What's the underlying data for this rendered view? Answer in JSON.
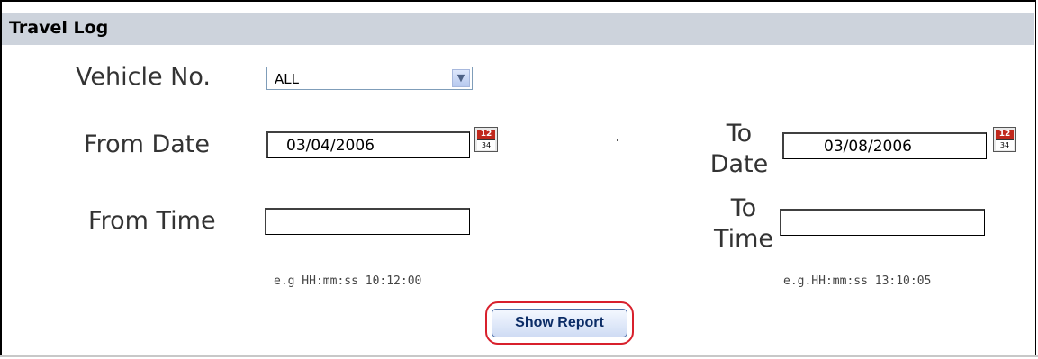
{
  "header": {
    "title": "Travel Log"
  },
  "form": {
    "vehicle_label": "Vehicle No.",
    "vehicle_value": "ALL",
    "from_date_label": "From Date",
    "from_date_value": "03/04/2006",
    "to_date_label_1": "To",
    "to_date_label_2": "Date",
    "to_date_value": "03/08/2006",
    "from_time_label": "From Time",
    "from_time_value": "",
    "to_time_label_1": "To",
    "to_time_label_2": "Time",
    "to_time_value": "",
    "from_time_hint": "e.g HH:mm:ss 10:12:00",
    "to_time_hint": "e.g.HH:mm:ss 13:10:05"
  },
  "icons": {
    "vehicle_dropdown": "chevron-down-icon",
    "from_date_picker": "calendar-icon",
    "to_date_picker": "calendar-icon",
    "calendar_top_text": "12",
    "calendar_grid_text": "34"
  },
  "actions": {
    "show_report_label": "Show Report"
  },
  "colors": {
    "header_bg": "#cdd3dc",
    "highlight_ring": "#d8202c",
    "button_text": "#0b2c66"
  }
}
